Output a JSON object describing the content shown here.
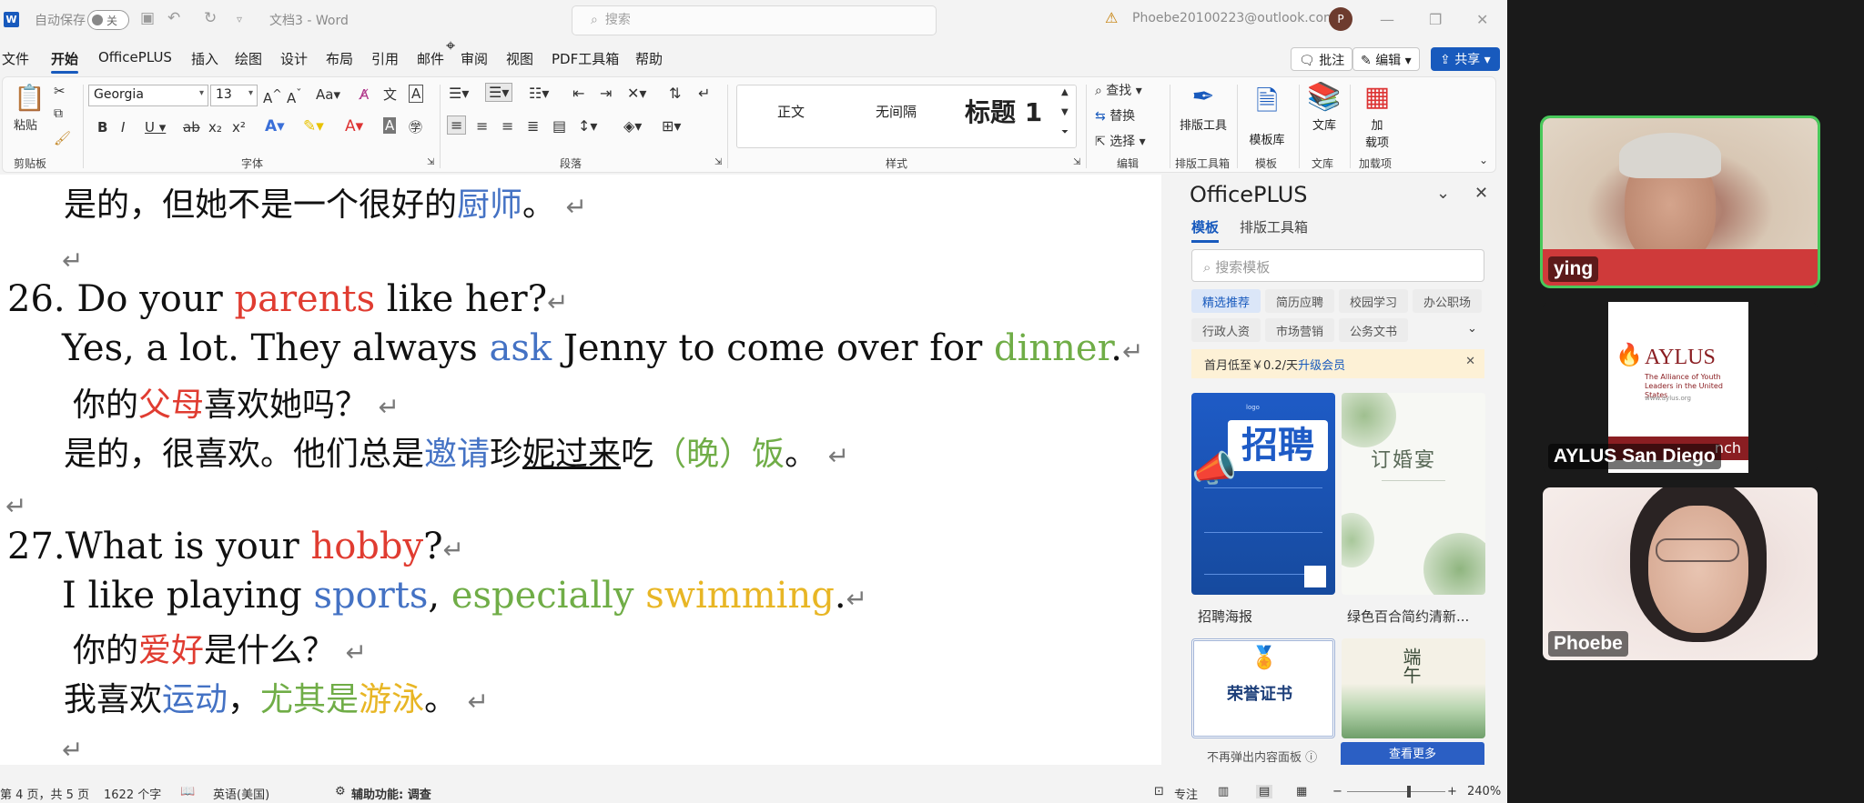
{
  "titlebar": {
    "app_icon": "W",
    "autosave_label": "自动保存",
    "autosave_state": "关",
    "doc_title": "文档3 - Word",
    "search_placeholder": "搜索",
    "account_email": "Phoebe20100223@outlook.com",
    "avatar_letter": "P"
  },
  "tabs": [
    "文件",
    "开始",
    "OfficePLUS",
    "插入",
    "绘图",
    "设计",
    "布局",
    "引用",
    "邮件",
    "审阅",
    "视图",
    "PDF工具箱",
    "帮助"
  ],
  "active_tab": "开始",
  "tab_actions": {
    "comments": "批注",
    "editing": "编辑",
    "share": "共享"
  },
  "ribbon": {
    "paste_label": "粘贴",
    "font_name": "Georgia",
    "font_size": "13",
    "style_normal": "正文",
    "style_no_spacing": "无间隔",
    "style_heading1": "标题 1",
    "find_label": "查找",
    "replace_label": "替换",
    "select_label": "选择",
    "layout_tools_label": "排版工具",
    "template_lib_label": "模板库",
    "library_label": "文库",
    "addin_label_1": "加",
    "addin_label_2": "载项",
    "groups": {
      "clipboard": "剪贴板",
      "font": "字体",
      "paragraph": "段落",
      "styles": "样式",
      "editing": "编辑",
      "layout_tools": "排版工具箱",
      "template": "模板",
      "library": "文库",
      "addins": "加载项"
    }
  },
  "document": {
    "l1": {
      "a": "是的，但她不是一个很好的",
      "b": "厨师",
      "c": "。"
    },
    "q26": {
      "a": "26. Do your ",
      "b": "parents",
      "c": " like her?"
    },
    "a26": {
      "a": "Yes, a lot. They always ",
      "b": "ask",
      "c": " Jenny to come over for ",
      "d": "dinner",
      "e": "."
    },
    "q26cn": {
      "a": "你的",
      "b": "父母",
      "c": "喜欢她吗？"
    },
    "a26cn": {
      "a": "是的，很喜欢。他们总是",
      "b": "邀请",
      "c": "珍",
      "d": "妮过来",
      "e": "吃",
      "f": "（晚）饭",
      "g": "。"
    },
    "q27": {
      "a": "27.What is your ",
      "b": "hobby",
      "c": "?"
    },
    "a27": {
      "a": "I like playing ",
      "b": "sports",
      "c": ", ",
      "d": "especially",
      "e": " ",
      "f": "swimming",
      "g": "."
    },
    "q27cn": {
      "a": "你的",
      "b": "爱好",
      "c": "是什么？"
    },
    "a27cn": {
      "a": "我喜欢",
      "b": "运动",
      "c": "，",
      "d": "尤其是",
      "e": "游泳",
      "f": "。"
    },
    "para_mark": "↵"
  },
  "pane": {
    "title": "OfficePLUS",
    "tab_templates": "模板",
    "tab_layout": "排版工具箱",
    "search_placeholder": "搜索模板",
    "chips": [
      "精选推荐",
      "简历应聘",
      "校园学习",
      "办公职场",
      "行政人资",
      "市场营销",
      "公务文书"
    ],
    "promo_text": "首月低至￥0.2/天",
    "promo_link": "升级会员",
    "thumb1_title": "招聘",
    "thumb1_label": "招聘海报",
    "thumb2_title": "订婚宴",
    "thumb2_label": "绿色百合简约清新...",
    "thumb3_title": "荣誉证书",
    "thumb4_title": "端午",
    "footer_text": "不再弹出内容面板",
    "more_button": "查看更多"
  },
  "status": {
    "page": "第 4 页，共 5 页",
    "words": "1622 个字",
    "language": "英语(美国)",
    "accessibility": "辅助功能: 调查",
    "focus": "专注",
    "zoom": "240%"
  },
  "video": {
    "p1_name": "ying",
    "p2_name": "AYLUS San Diego",
    "p2_slide_title": "AYLUS",
    "p2_slide_sub": "The Alliance of Youth Leaders in the United States",
    "p2_slide_url": "www.aylus.org",
    "p2_slide_tag": "nch",
    "p3_name": "Phoebe"
  }
}
